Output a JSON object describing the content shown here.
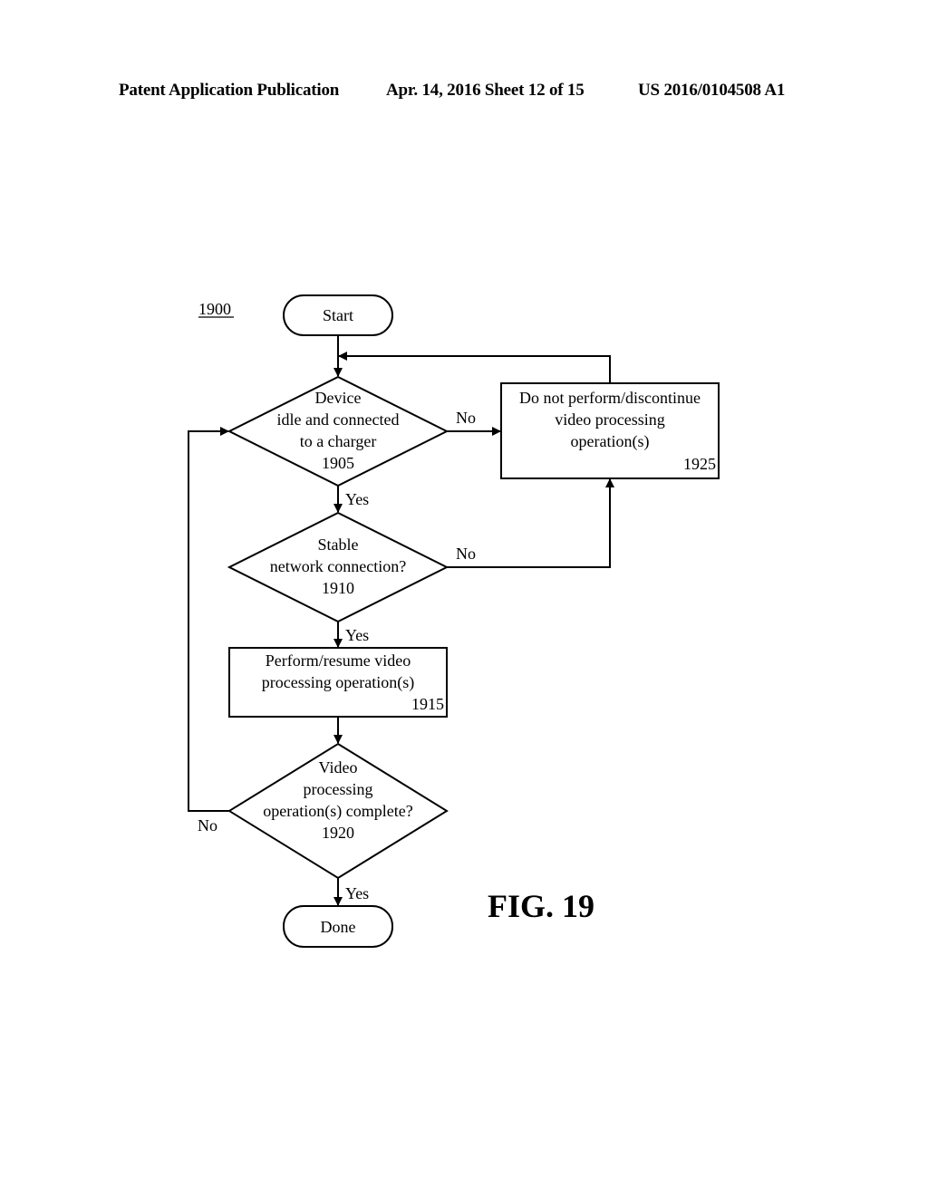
{
  "header": {
    "publication": "Patent Application Publication",
    "date_sheet": "Apr. 14, 2016  Sheet 12 of 15",
    "number": "US 2016/0104508 A1"
  },
  "diagram": {
    "ref_label": "1900",
    "figure_label": "FIG. 19",
    "start": {
      "label": "Start"
    },
    "done": {
      "label": "Done"
    },
    "step_1905": {
      "lines": [
        "Device",
        "idle and connected",
        "to a charger"
      ],
      "ref": "1905"
    },
    "step_1910": {
      "lines": [
        "Stable",
        "network connection?"
      ],
      "ref": "1910"
    },
    "step_1915": {
      "lines": [
        "Perform/resume video",
        "processing operation(s)"
      ],
      "ref": "1915"
    },
    "step_1920": {
      "lines": [
        "Video",
        "processing",
        "operation(s) complete?"
      ],
      "ref": "1920"
    },
    "step_1925": {
      "lines": [
        "Do not perform/discontinue",
        "video processing",
        "operation(s)"
      ],
      "ref": "1925"
    },
    "edges": {
      "e1905_yes": "Yes",
      "e1905_no": "No",
      "e1910_yes": "Yes",
      "e1910_no": "No",
      "e1920_yes": "Yes",
      "e1920_no": "No"
    }
  }
}
